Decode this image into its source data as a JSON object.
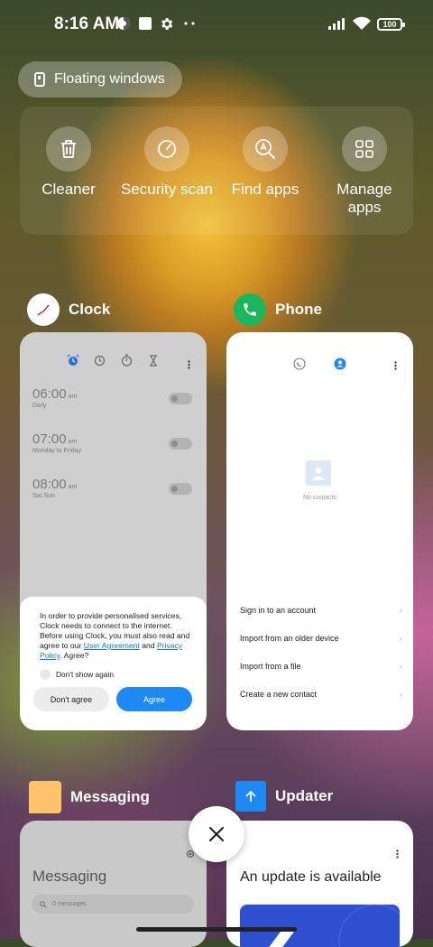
{
  "status_bar": {
    "time": "8:16 AM",
    "battery": "100",
    "icons": [
      "data-saver-icon",
      "square-notification-icon",
      "gear-icon",
      "more-dots-icon",
      "signal-icon",
      "wifi-icon",
      "battery-icon"
    ]
  },
  "floating_windows": {
    "label": "Floating windows"
  },
  "tools": [
    {
      "label": "Cleaner",
      "icon": "trash-icon"
    },
    {
      "label": "Security scan",
      "icon": "security-scan-icon"
    },
    {
      "label": "Find apps",
      "icon": "find-apps-icon"
    },
    {
      "label": "Manage apps",
      "icon": "grid-icon"
    }
  ],
  "apps": {
    "clock": {
      "title": "Clock",
      "alarms": [
        {
          "time": "06:00",
          "ampm": "am",
          "days": "Daily"
        },
        {
          "time": "07:00",
          "ampm": "am",
          "days": "Monday to Friday"
        },
        {
          "time": "08:00",
          "ampm": "am",
          "days": "Sat Sun"
        }
      ],
      "dialog": {
        "text_before": "In order to provide personalised services, Clock needs to connect to the internet. Before using Clock, you must also read and agree to our ",
        "link1": "User Agreement",
        "and": " and ",
        "link2": "Privacy Policy",
        "text_after": ". Agree?",
        "checkbox": "Don't show again",
        "disagree": "Don't agree",
        "agree": "Agree"
      }
    },
    "phone": {
      "title": "Phone",
      "empty": "No contacts",
      "options": [
        "Sign in to an account",
        "Import from an older device",
        "Import from a file",
        "Create a new contact"
      ]
    },
    "messaging": {
      "title": "Messaging",
      "header": "Messaging",
      "search_placeholder": "0 messages"
    },
    "updater": {
      "title": "Updater",
      "headline": "An update is available"
    }
  },
  "colors": {
    "agree_button": "#1e88f5",
    "phone_icon": "#1bb55c",
    "updater_icon": "#1e88f5",
    "messaging_icon": "#ffc46b"
  }
}
